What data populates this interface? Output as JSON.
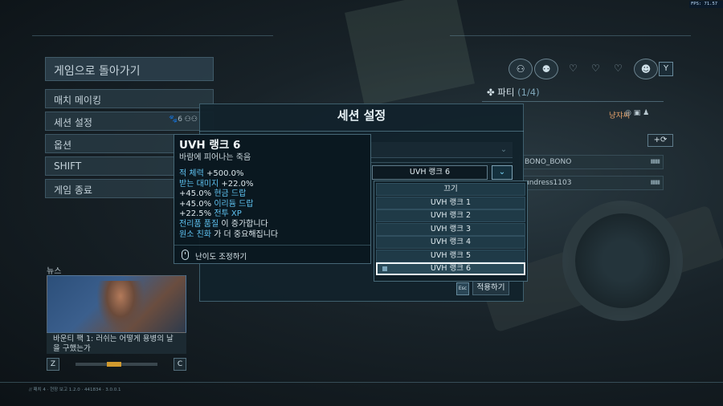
{
  "fps": "FPS: 71.57",
  "menu": {
    "back": "게임으로 돌아가기",
    "items": [
      {
        "label": "매치 메이킹"
      },
      {
        "label": "세션 설정"
      },
      {
        "label": "옵션"
      },
      {
        "label": "SHIFT"
      },
      {
        "label": "게임 종료"
      }
    ],
    "session_icons": "🐾6 ⚇⚇"
  },
  "news": {
    "label": "뉴스",
    "caption": "바운티 팩 1: 러쉬는 어떻게 용병의 날을 구했는가",
    "prev_key": "Z",
    "next_key": "C"
  },
  "version": "// 패치 4 · 현장 보고 1.2.0 · 441834 · 3.0.0.1",
  "party": {
    "title": "파티",
    "count": "(1/4)",
    "leader": "냥쟈씨",
    "y_key": "Y",
    "plus": "+⟳",
    "members": [
      "BONO_BONO",
      "undress1103"
    ],
    "signal": "▮▮▮▮"
  },
  "dialog": {
    "title": "세션 설정",
    "select_value": "UVH 랭크 6",
    "options": [
      "끄기",
      "UVH 랭크 1",
      "UVH 랭크 2",
      "UVH 랭크 3",
      "UVH 랭크 4",
      "UVH 랭크 5",
      "UVH 랭크 6"
    ],
    "selected_index": 6,
    "apply_key": "Esc",
    "apply_label": "적용하기"
  },
  "tooltip": {
    "title": "UVH 랭크 6",
    "subtitle": "바람에 피어나는 죽음",
    "lines": [
      {
        "hl": "적 체력",
        "rest": " +500.0%"
      },
      {
        "hl": "받는 대미지",
        "rest": " +22.0%"
      },
      {
        "pre": "+45.0% ",
        "hl": "현금 드랍"
      },
      {
        "pre": "+45.0% ",
        "hl": "이리듐 드랍"
      },
      {
        "pre": "+22.5% ",
        "hl": "전투 XP"
      },
      {
        "hl": "전리품 품질",
        "rest": " 이 증가합니다"
      },
      {
        "hl": "원소 친화",
        "rest": " 가 더 중요해집니다"
      }
    ],
    "footer": "난이도 조정하기"
  },
  "colors": {
    "highlight": "#5fc3f2",
    "leader": "#e2a06a",
    "accent": "#7fdcff"
  }
}
